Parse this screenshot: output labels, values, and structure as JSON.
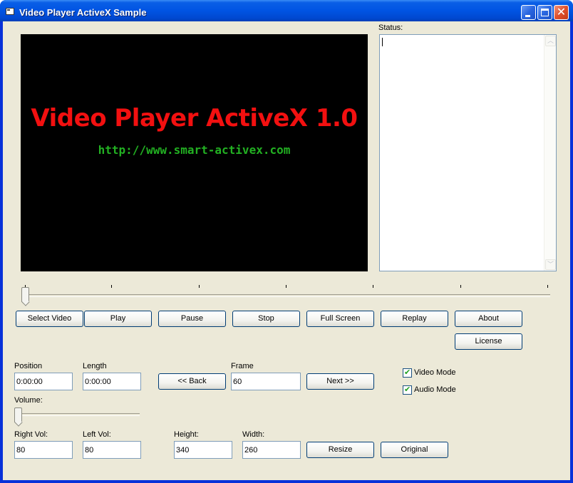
{
  "window": {
    "title": "Video Player ActiveX Sample",
    "controls": [
      "minimize",
      "maximize",
      "close"
    ]
  },
  "video": {
    "title": "Video Player ActiveX 1.0",
    "url": "http://www.smart-activex.com",
    "title_color": "#f21010",
    "url_color": "#22b022"
  },
  "status": {
    "label": "Status:",
    "text": ""
  },
  "seek_slider": {
    "value_percent": 0,
    "tick_count": 7
  },
  "buttons": {
    "select_video": "Select Video",
    "play": "Play",
    "pause": "Pause",
    "stop": "Stop",
    "full_screen": "Full Screen",
    "replay": "Replay",
    "about": "About",
    "license": "License",
    "back": "<< Back",
    "next": "Next >>",
    "resize": "Resize",
    "original": "Original"
  },
  "fields": {
    "position": {
      "label": "Position",
      "value": "0:00:00"
    },
    "length": {
      "label": "Length",
      "value": "0:00:00"
    },
    "frame": {
      "label": "Frame",
      "value": "60"
    },
    "right_vol": {
      "label": "Right Vol:",
      "value": "80"
    },
    "left_vol": {
      "label": "Left Vol:",
      "value": "80"
    },
    "height": {
      "label": "Height:",
      "value": "340"
    },
    "width": {
      "label": "Width:",
      "value": "260"
    }
  },
  "volume": {
    "label": "Volume:",
    "value_percent": 0
  },
  "checkboxes": {
    "video_mode": {
      "label": "Video Mode",
      "checked": true
    },
    "audio_mode": {
      "label": "Audio Mode",
      "checked": true
    }
  }
}
